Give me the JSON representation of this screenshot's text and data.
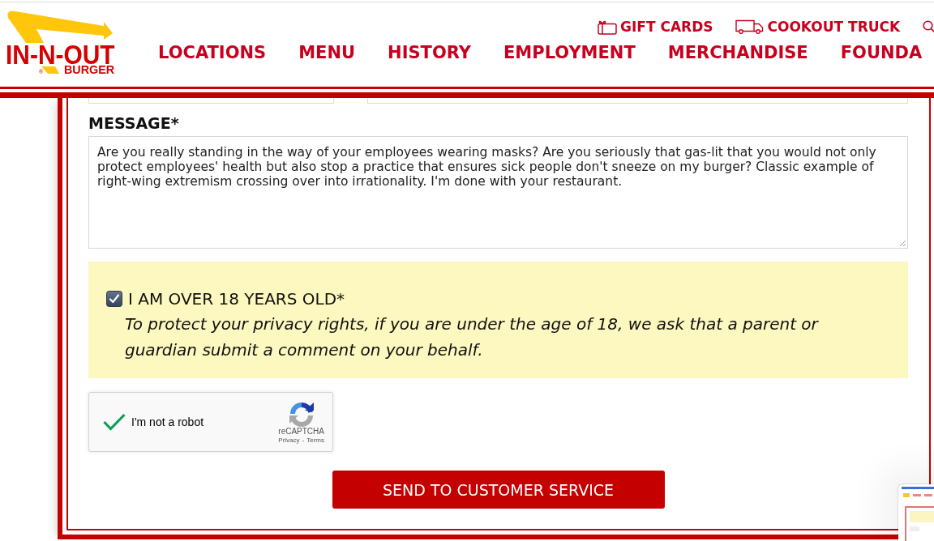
{
  "header": {
    "logo": {
      "wordmark": "IN-N-OUT",
      "tagline": "BURGER",
      "registered": "®"
    },
    "utility_links": [
      {
        "kind": "gift",
        "label": "GIFT CARDS"
      },
      {
        "kind": "truck",
        "label": "COOKOUT TRUCK"
      },
      {
        "kind": "search"
      }
    ],
    "nav": [
      "LOCATIONS",
      "MENU",
      "HISTORY",
      "EMPLOYMENT",
      "MERCHANDISE",
      "FOUNDA"
    ]
  },
  "form": {
    "message": {
      "label": "MESSAGE*",
      "value": "Are you really standing in the way of your employees wearing masks? Are you seriously that gas-lit that you would not only protect employees' health but also stop a practice that ensures sick people don't sneeze on my burger? Classic example of right-wing extremism crossing over into irrationality. I'm done with your restaurant."
    },
    "age_confirmation": {
      "checked": true,
      "label": "I AM OVER 18 YEARS OLD*",
      "note": "To protect your privacy rights, if you are under the age of 18, we ask that a parent or guardian submit a comment on your behalf."
    },
    "captcha": {
      "checked": true,
      "label": "I'm not a robot",
      "brand": "reCAPTCHA",
      "legal_links": [
        "Privacy",
        "Terms"
      ],
      "legal_separator": "-"
    },
    "submit": "SEND TO CUSTOMER SERVICE"
  }
}
